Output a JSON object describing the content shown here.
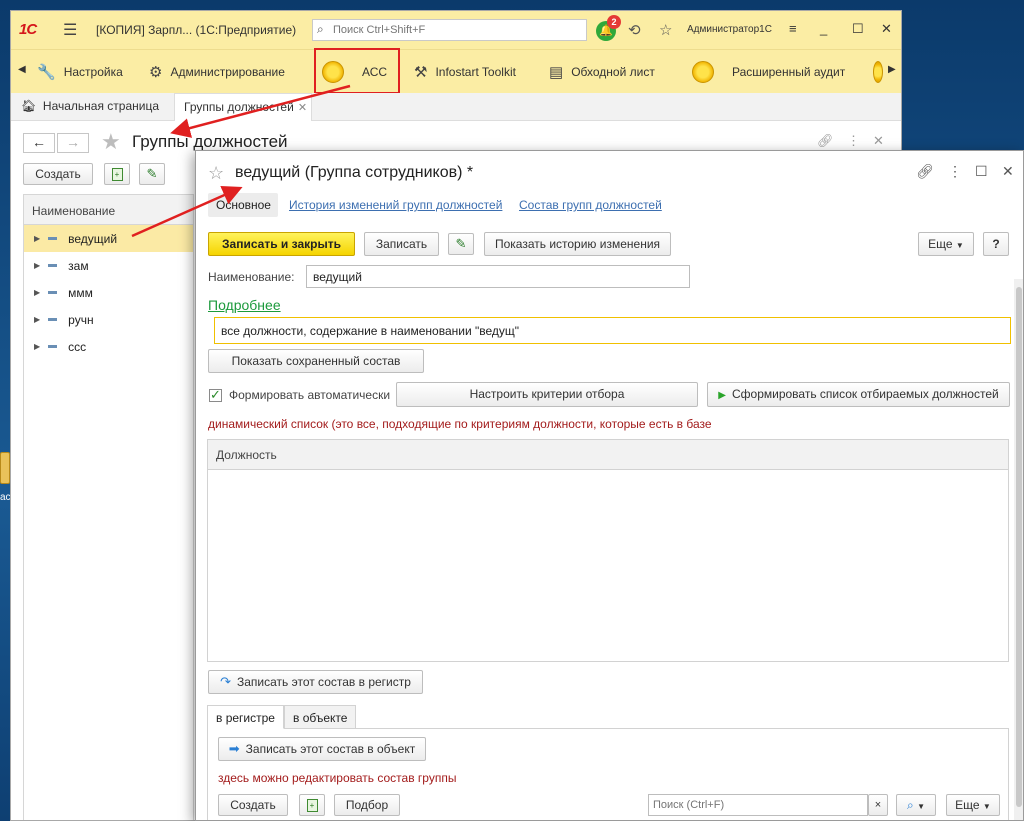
{
  "desktop": {
    "icon_label": "ас"
  },
  "window": {
    "logo": "1С",
    "title": "[КОПИЯ] Зарпл...  (1С:Предприятие)",
    "search_placeholder": "Поиск Ctrl+Shift+F",
    "notification_count": "2",
    "user": "Администратор1С"
  },
  "sections": [
    {
      "label": "Настройка",
      "icon": "wrench-icon"
    },
    {
      "label": "Администрирование",
      "icon": "gear-icon"
    },
    {
      "label": "АСС",
      "icon": "coin-icon"
    },
    {
      "label": "Infostart Toolkit",
      "icon": "tools-icon"
    },
    {
      "label": "Обходной лист",
      "icon": "list-icon"
    },
    {
      "label": "Расширенный аудит",
      "icon": "coin-icon"
    }
  ],
  "tabs": {
    "home": "Начальная страница",
    "active": "Группы должностей"
  },
  "list": {
    "title": "Группы должностей",
    "create_label": "Создать",
    "column_header": "Наименование",
    "rows": [
      "ведущий",
      "зам",
      "ммм",
      "ручн",
      "ссс"
    ],
    "selected_index": 0
  },
  "form": {
    "title": "ведущий (Группа сотрудников) *",
    "tabs": [
      "Основное",
      "История изменений групп должностей",
      "Состав групп должностей"
    ],
    "buttons": {
      "save_close": "Записать и закрыть",
      "save": "Записать",
      "show_history": "Показать историю изменения",
      "more": "Еще",
      "help": "?"
    },
    "name_label": "Наименование:",
    "name_value": "ведущий",
    "details_link": "Подробнее",
    "details_value": "все должности, содержание в наименовании \"ведущ\"",
    "show_saved": "Показать сохраненный состав",
    "auto_label": "Формировать автоматически",
    "auto_checked": true,
    "criteria_btn": "Настроить критерии отбора",
    "form_list_btn": "Сформировать список отбираемых должностей",
    "dynamic_note": "динамический список (это все, подходящие по критериям должности, которые есть в базе",
    "positions_header": "Должность",
    "write_register": "Записать этот состав в регистр",
    "bottom_tabs": [
      "в регистре",
      "в объекте"
    ],
    "write_object": "Записать этот состав в объект",
    "edit_note": "здесь можно редактировать состав группы",
    "create_label": "Создать",
    "pick_label": "Подбор",
    "search_placeholder": "Поиск (Ctrl+F)",
    "search_clear": "×",
    "more2": "Еще"
  },
  "colors": {
    "accent": "#fbeda4",
    "primary": "#f5d400",
    "annotation": "#e02020",
    "link": "#3d6fb0"
  }
}
